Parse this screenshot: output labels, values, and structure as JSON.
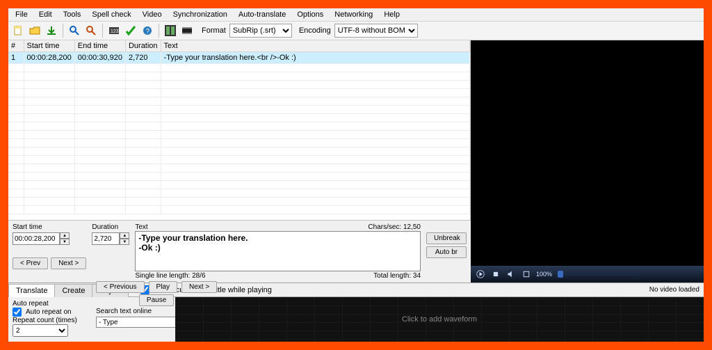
{
  "menu": [
    "File",
    "Edit",
    "Tools",
    "Spell check",
    "Video",
    "Synchronization",
    "Auto-translate",
    "Options",
    "Networking",
    "Help"
  ],
  "toolbar": {
    "format_label": "Format",
    "format_value": "SubRip (.srt)",
    "encoding_label": "Encoding",
    "encoding_value": "UTF-8 without BOM"
  },
  "grid": {
    "headers": {
      "num": "#",
      "start": "Start time",
      "end": "End time",
      "dur": "Duration",
      "text": "Text"
    },
    "rows": [
      {
        "num": "1",
        "start": "00:00:28,200",
        "end": "00:00:30,920",
        "dur": "2,720",
        "text": "-Type your translation here.<br />-Ok :)"
      }
    ]
  },
  "editor": {
    "start_label": "Start time",
    "start_value": "00:00:28,200",
    "dur_label": "Duration",
    "dur_value": "2,720",
    "prev": "< Prev",
    "next": "Next >",
    "text_label": "Text",
    "chars_sec": "Chars/sec: 12,50",
    "text_value": "-Type your translation here.\n-Ok :)",
    "single_len": "Single line length: 28/6",
    "total_len": "Total length: 34",
    "unbreak": "Unbreak",
    "autobr": "Auto br"
  },
  "video": {
    "pct": "100%"
  },
  "bottom": {
    "tabs": [
      "Translate",
      "Create",
      "Adjust"
    ],
    "active_tab": 0,
    "select_while_playing": "Select current subtitle while playing",
    "no_video": "No video loaded",
    "auto_repeat_title": "Auto repeat",
    "auto_repeat_on": "Auto repeat on",
    "repeat_count_label": "Repeat count (times)",
    "repeat_count_value": "2",
    "btn_prev": "< Previous",
    "btn_play": "Play",
    "btn_next": "Next >",
    "btn_pause": "Pause",
    "search_label": "Search text online",
    "search_value": "- Type",
    "waveform_hint": "Click to add waveform"
  }
}
